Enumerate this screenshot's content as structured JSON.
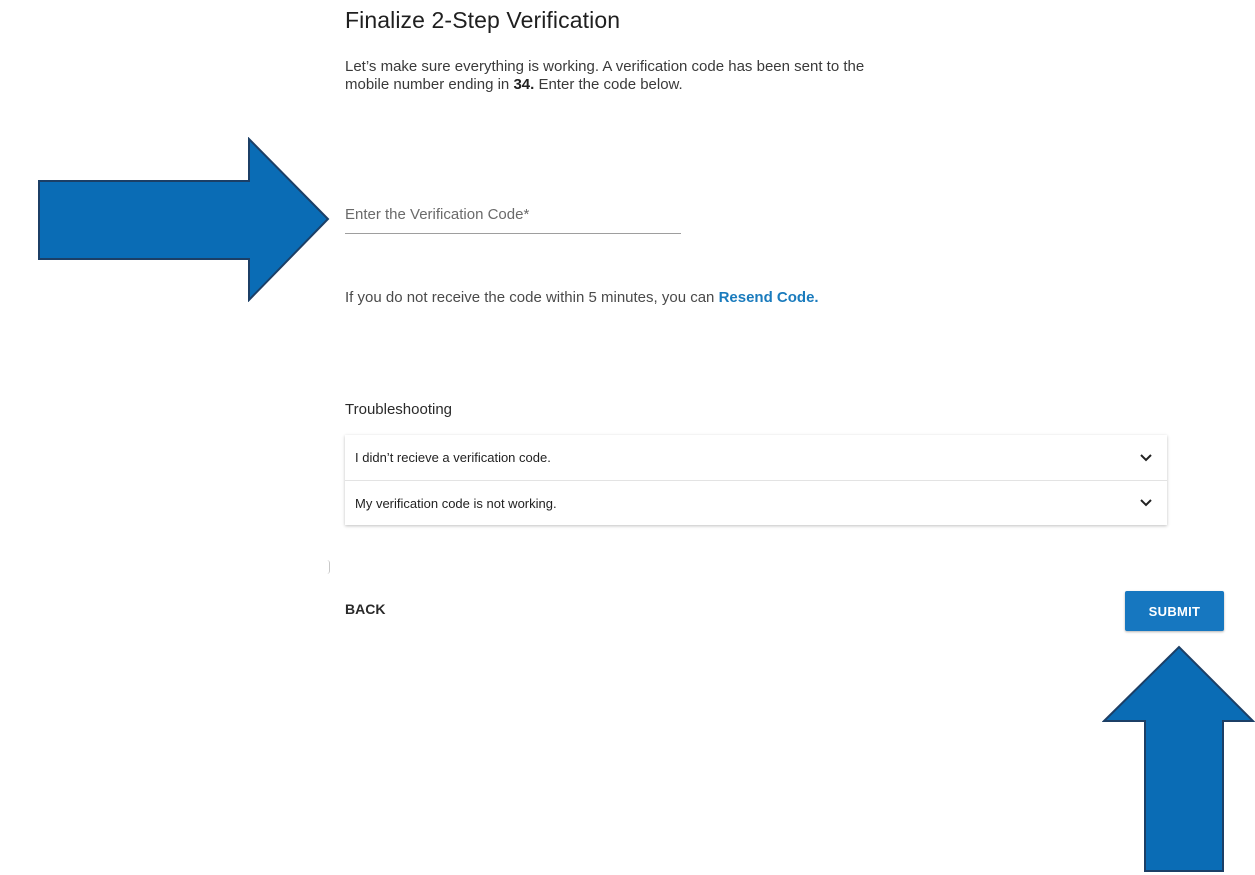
{
  "header": {
    "title": "Finalize 2-Step Verification"
  },
  "intro": {
    "text_before": "Let’s make sure everything is working. A verification code has been sent to the mobile number ending in ",
    "number_suffix": "34.",
    "text_after": " Enter the code below."
  },
  "code_input": {
    "placeholder": "Enter the Verification Code*",
    "value": ""
  },
  "resend": {
    "text": "If you do not receive the code within 5 minutes, you can ",
    "link_label": "Resend Code."
  },
  "troubleshooting": {
    "heading": "Troubleshooting",
    "items": [
      {
        "label": "I didn’t recieve a verification code.",
        "icon": "chevron-down-icon"
      },
      {
        "label": "My verification code is not working.",
        "icon": "chevron-down-icon"
      }
    ]
  },
  "actions": {
    "back_label": "BACK",
    "submit_label": "SUBMIT"
  },
  "annotations": {
    "arrow_color": "#0a6cb5",
    "arrow_outline": "#1c3f66",
    "left_arrow_icon": "arrow-right-icon",
    "bottom_arrow_icon": "arrow-up-icon"
  },
  "colors": {
    "accent": "#1677c0",
    "link": "#1a7bbd"
  }
}
